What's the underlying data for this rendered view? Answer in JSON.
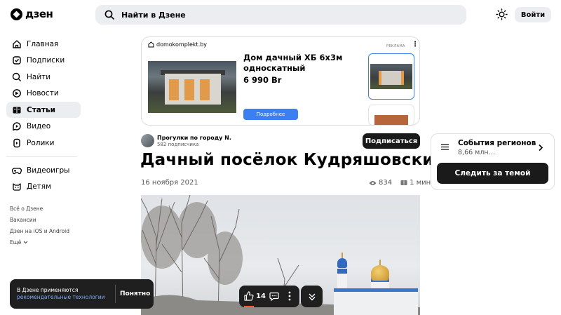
{
  "header": {
    "logo": "дзен",
    "search_placeholder": "Найти в Дзене",
    "login_label": "Войти"
  },
  "sidebar": {
    "items": [
      {
        "label": "Главная",
        "icon": "home-icon"
      },
      {
        "label": "Подписки",
        "icon": "subscriptions-icon"
      },
      {
        "label": "Найти",
        "icon": "search-icon"
      },
      {
        "label": "Новости",
        "icon": "news-icon"
      },
      {
        "label": "Статьи",
        "icon": "articles-icon",
        "active": true
      },
      {
        "label": "Видео",
        "icon": "video-icon"
      },
      {
        "label": "Ролики",
        "icon": "shorts-icon"
      },
      {
        "label": "Видеоигры",
        "icon": "gamepad-icon"
      },
      {
        "label": "Детям",
        "icon": "kids-icon"
      }
    ],
    "footer_links": [
      "Всё о Дзене",
      "Вакансии",
      "Дзен на iOS и Android",
      "Ещё"
    ]
  },
  "ad": {
    "domain": "domokomplekt.by",
    "label": "РЕКЛАМА",
    "title": "Дом дачный ХБ 6х3м односкатный",
    "price": "6 990 Br",
    "button": "Подробнее"
  },
  "article": {
    "channel_name": "Прогулки по городу N.",
    "channel_subs": "582 подписчика",
    "subscribe_label": "Подписаться",
    "title": "Дачный посёлок Кудряшовский",
    "date": "16 ноября 2021",
    "views": "834",
    "read_time": "1 мин"
  },
  "topic_panel": {
    "title": "События регионов",
    "count": "8,66 млн…",
    "button": "Следить за темой"
  },
  "cookie": {
    "text": "В Дзене применяются",
    "link": "рекомендательные технологии",
    "button": "Понятно"
  },
  "actions": {
    "likes": "14"
  }
}
